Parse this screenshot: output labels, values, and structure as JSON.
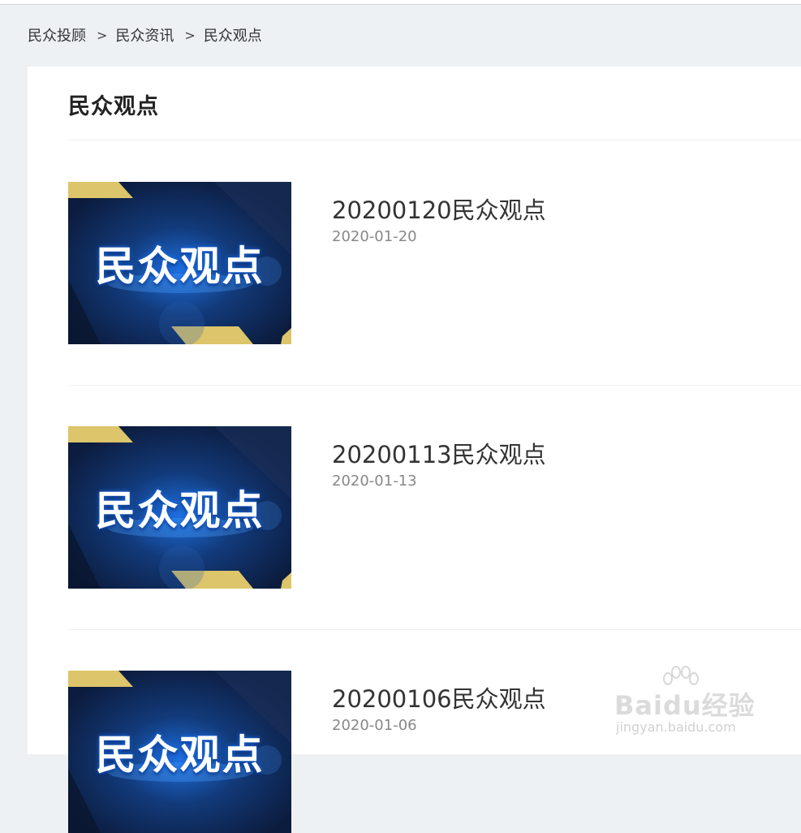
{
  "breadcrumb": {
    "items": [
      "民众投顾",
      "民众资讯",
      "民众观点"
    ],
    "separator": ">"
  },
  "page": {
    "title": "民众观点"
  },
  "articles": [
    {
      "title": "20200120民众观点",
      "date": "2020-01-20",
      "thumb_text": "民众观点"
    },
    {
      "title": "20200113民众观点",
      "date": "2020-01-13",
      "thumb_text": "民众观点"
    },
    {
      "title": "20200106民众观点",
      "date": "2020-01-06",
      "thumb_text": "民众观点"
    }
  ],
  "watermark": {
    "brand": "Baidu经验",
    "url": "jingyan.baidu.com"
  },
  "colors": {
    "background": "#eef1f4",
    "card": "#ffffff",
    "thumb_navy": "#0f2347",
    "thumb_gold": "#dcc56a",
    "thumb_glow": "#1e78ff"
  }
}
